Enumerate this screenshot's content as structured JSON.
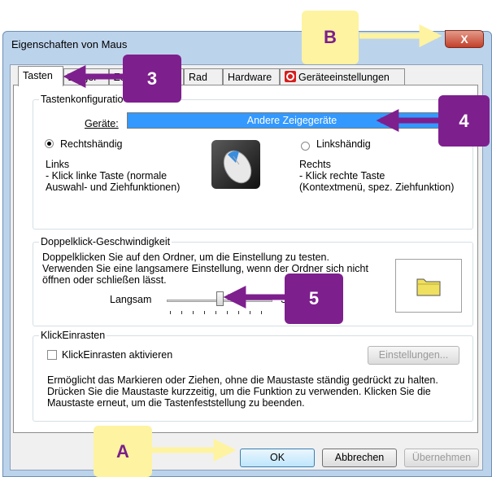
{
  "window": {
    "title": "Eigenschaften von Maus",
    "close_label": "X"
  },
  "tabs": [
    {
      "label": "Tasten"
    },
    {
      "label": "Zeiger"
    },
    {
      "label": "Ze"
    },
    {
      "label": "Rad"
    },
    {
      "label": "Hardware"
    },
    {
      "label": "Geräteeinstellungen"
    }
  ],
  "tasten": {
    "group_label": "Tastenkonfiguratio",
    "device_label": "Geräte:",
    "device_value": "Andere Zeigegeräte",
    "right_radio": "Rechtshändig",
    "left_radio": "Linkshändig",
    "left_title": "Links",
    "left_desc_1": " - Klick linke Taste (normale",
    "left_desc_2": "Auswahl- und Ziehfunktionen)",
    "right_title": "Rechts",
    "right_desc_1": " - Klick rechte Taste",
    "right_desc_2": "(Kontextmenü, spez. Ziehfunktion)"
  },
  "doubleclick": {
    "group_label": "Doppelklick-Geschwindigkeit",
    "line1": "Doppelklicken Sie auf den Ordner, um die Einstellung zu testen.",
    "line2": "Verwenden Sie eine langsamere Einstellung, wenn der Ordner sich nicht",
    "line3": "öffnen oder schließen lässt.",
    "slow_label": "Langsam",
    "fast_label": "S",
    "slider_value": 0.5
  },
  "clicklock": {
    "group_label": "KlickEinrasten",
    "checkbox_label": "KlickEinrasten aktivieren",
    "settings_button": "Einstellungen...",
    "desc_1": "Ermöglicht das Markieren oder Ziehen, ohne die Maustaste ständig gedrückt zu halten.",
    "desc_2": "Drücken Sie die Maustaste kurzzeitig, um die Funktion zu verwenden. Klicken Sie die",
    "desc_3": "Maustaste erneut, um die Tastenfeststellung zu beenden."
  },
  "buttons": {
    "ok": "OK",
    "cancel": "Abbrechen",
    "apply": "Übernehmen"
  },
  "callouts": {
    "A": "A",
    "B": "B",
    "n3": "3",
    "n4": "4",
    "n5": "5"
  },
  "colors": {
    "accent_purple": "#7e1f8e",
    "callout_yellow": "#fef3a0",
    "selection_blue": "#3399ff"
  }
}
